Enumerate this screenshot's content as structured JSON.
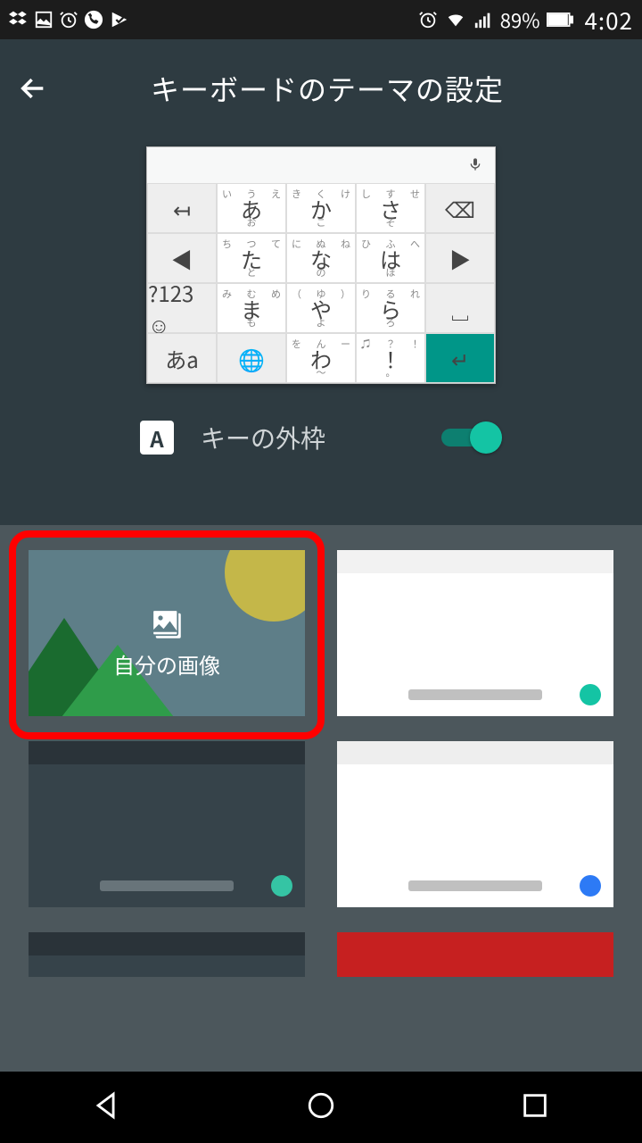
{
  "status": {
    "battery_pct": "89%",
    "time": "4:02"
  },
  "appbar": {
    "title": "キーボードのテーマの設定"
  },
  "keyboard_preview": {
    "rows": [
      [
        {
          "type": "func",
          "main": "↤"
        },
        {
          "main": "あ",
          "tl": "い",
          "tr": "え",
          "tc": "う",
          "bc": "お"
        },
        {
          "main": "か",
          "tl": "き",
          "tr": "け",
          "tc": "く",
          "bc": "こ"
        },
        {
          "main": "さ",
          "tl": "し",
          "tr": "せ",
          "tc": "す",
          "bc": "そ"
        },
        {
          "type": "func",
          "main": "⌫"
        }
      ],
      [
        {
          "type": "func",
          "main": "◀"
        },
        {
          "main": "た",
          "tl": "ち",
          "tr": "て",
          "tc": "つ",
          "bc": "と"
        },
        {
          "main": "な",
          "tl": "に",
          "tr": "ね",
          "tc": "ぬ",
          "bc": "の"
        },
        {
          "main": "は",
          "tl": "ひ",
          "tr": "へ",
          "tc": "ふ",
          "bc": "ほ"
        },
        {
          "type": "func",
          "main": "▶"
        }
      ],
      [
        {
          "type": "func",
          "main": "?123 ☺"
        },
        {
          "main": "ま",
          "tl": "み",
          "tr": "め",
          "tc": "む",
          "bc": "も"
        },
        {
          "main": "や",
          "tl": "（",
          "tr": "）",
          "tc": "ゆ",
          "bc": "よ"
        },
        {
          "main": "ら",
          "tl": "り",
          "tr": "れ",
          "tc": "る",
          "bc": "ろ"
        },
        {
          "type": "func",
          "main": "␣"
        }
      ],
      [
        {
          "type": "func",
          "main": "あa"
        },
        {
          "type": "func",
          "main": "🌐"
        },
        {
          "main": "わ",
          "tl": "を",
          "tr": "ー",
          "tc": "ん",
          "bc": "〜"
        },
        {
          "main": "！",
          "tl": "♫",
          "tr": "！",
          "tc": "？",
          "bc": "。"
        },
        {
          "type": "enter",
          "main": "↵"
        }
      ]
    ]
  },
  "outline_toggle": {
    "icon_letter": "A",
    "label": "キーの外枠",
    "on": true
  },
  "themes": {
    "custom_label": "自分の画像",
    "items": [
      {
        "id": "custom",
        "highlighted": true
      },
      {
        "id": "white-selected",
        "dot": "#14c4a4",
        "selected": true
      },
      {
        "id": "dark",
        "dot": "#35c4a4"
      },
      {
        "id": "light",
        "dot": "#2d7af5"
      },
      {
        "id": "partial-dark"
      },
      {
        "id": "partial-red"
      }
    ]
  }
}
